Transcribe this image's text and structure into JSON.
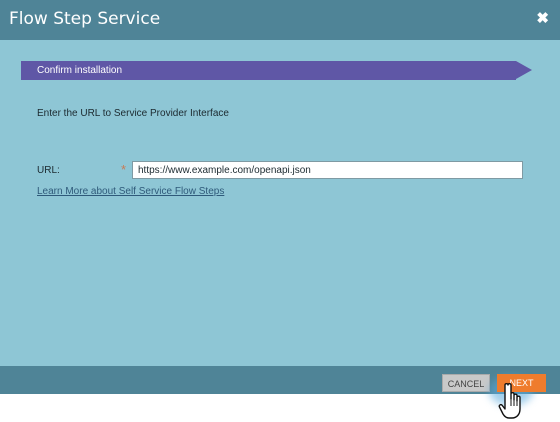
{
  "dialog": {
    "title": "Flow Step Service",
    "close_icon": "close-icon"
  },
  "step": {
    "label": "Confirm installation",
    "color": "#5f57a6"
  },
  "form": {
    "instruction": "Enter the URL to Service Provider Interface",
    "url_label": "URL:",
    "required_marker": "*",
    "url_value": "https://www.example.com/openapi.json",
    "learn_more_link": "Learn More about Self Service Flow Steps"
  },
  "footer": {
    "cancel_label": "CANCEL",
    "next_label": "NEXT",
    "next_color": "#ef7c2d"
  },
  "pointer": {
    "icon": "hand-pointer-icon"
  }
}
